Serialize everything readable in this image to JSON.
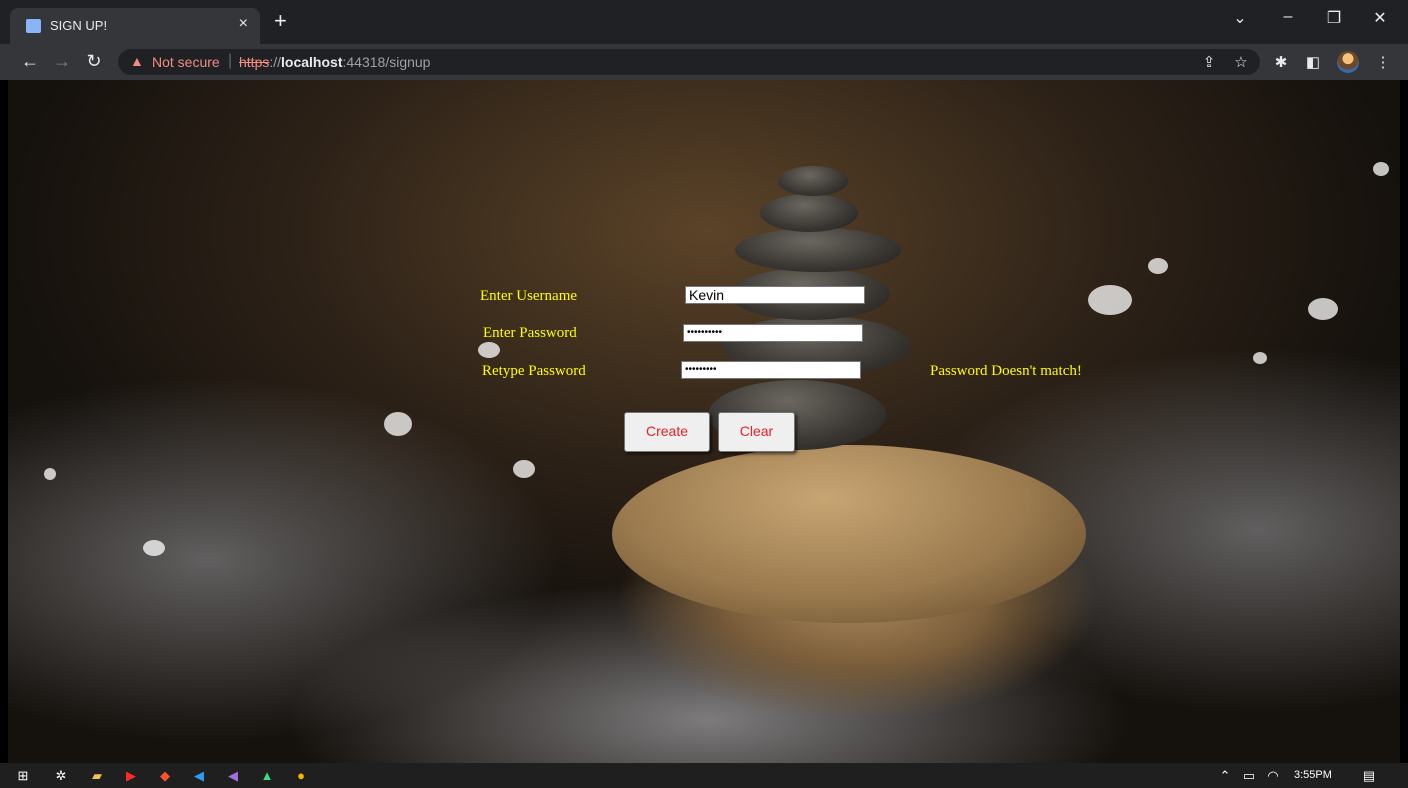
{
  "browser": {
    "tab_title": "SIGN UP!",
    "tab_close": "×",
    "new_tab": "+",
    "address": {
      "security_label": "Not secure",
      "separator": "|",
      "scheme": "https",
      "scheme_sep": "://",
      "host": "localhost",
      "port_path": ":44318/signup"
    },
    "window_controls": {
      "dropdown": "⌄",
      "minimize": "–",
      "restore": "❐",
      "close": "✕"
    }
  },
  "form": {
    "username_label": "Enter Username",
    "password_label": "Enter Password",
    "retype_label": "Retype Password",
    "username_value": "Kevin",
    "password_value": "••••••••••",
    "retype_value": "•••••••••",
    "error_message": "Password Doesn't match!",
    "create_button": "Create",
    "clear_button": "Clear",
    "label_color": "#ffff00",
    "button_text_color": "#e8202a"
  },
  "taskbar": {
    "time": "3:55PM"
  },
  "icons": [
    "windows-start-icon",
    "settings-icon",
    "file-explorer-icon",
    "youtube-icon",
    "brave-icon",
    "vscode-icon",
    "visual-studio-icon",
    "android-studio-icon",
    "chrome-icon"
  ]
}
